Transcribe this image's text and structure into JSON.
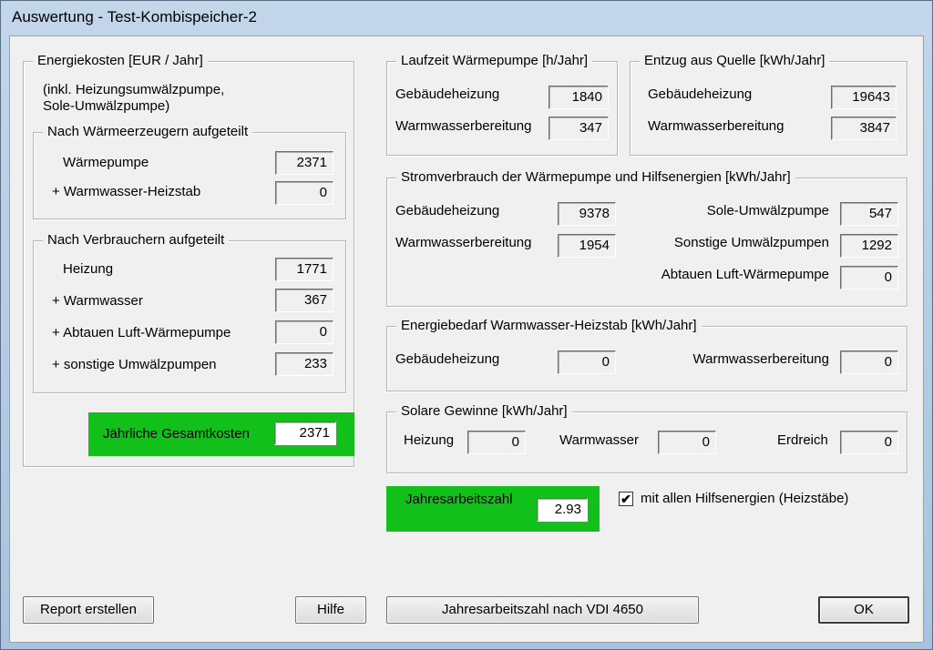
{
  "window": {
    "title": "Auswertung - Test-Kombispeicher-2"
  },
  "energiekosten": {
    "title": "Energiekosten [EUR / Jahr]",
    "note": "(inkl. Heizungsumwälzpumpe,\nSole-Umwälzpumpe)",
    "waermeerzeuger": {
      "title": "Nach Wärmeerzeugern aufgeteilt",
      "rows": [
        {
          "label": "Wärmepumpe",
          "value": "2371"
        },
        {
          "label": "+ Warmwasser-Heizstab",
          "value": "0"
        }
      ]
    },
    "verbraucher": {
      "title": "Nach Verbrauchern aufgeteilt",
      "rows": [
        {
          "label": "Heizung",
          "value": "1771"
        },
        {
          "label": "+ Warmwasser",
          "value": "367"
        },
        {
          "label": "+ Abtauen Luft-Wärmepumpe",
          "value": "0"
        },
        {
          "label": "+ sonstige Umwälzpumpen",
          "value": "233"
        }
      ]
    },
    "gesamt": {
      "label": "Jährliche Gesamtkosten",
      "value": "2371"
    }
  },
  "laufzeit": {
    "title": "Laufzeit Wärmepumpe [h/Jahr]",
    "rows": [
      {
        "label": "Gebäudeheizung",
        "value": "1840"
      },
      {
        "label": "Warmwasserbereitung",
        "value": "347"
      }
    ]
  },
  "entzug": {
    "title": "Entzug aus Quelle [kWh/Jahr]",
    "rows": [
      {
        "label": "Gebäudeheizung",
        "value": "19643"
      },
      {
        "label": "Warmwasserbereitung",
        "value": "3847"
      }
    ]
  },
  "strom": {
    "title": "Stromverbrauch der Wärmepumpe und Hilfsenergien [kWh/Jahr]",
    "left": [
      {
        "label": "Gebäudeheizung",
        "value": "9378"
      },
      {
        "label": "Warmwasserbereitung",
        "value": "1954"
      }
    ],
    "right": [
      {
        "label": "Sole-Umwälzpumpe",
        "value": "547"
      },
      {
        "label": "Sonstige Umwälzpumpen",
        "value": "1292"
      },
      {
        "label": "Abtauen Luft-Wärmepumpe",
        "value": "0"
      }
    ]
  },
  "heizstab": {
    "title": "Energiebedarf Warmwasser-Heizstab [kWh/Jahr]",
    "gebaeude": {
      "label": "Gebäudeheizung",
      "value": "0"
    },
    "warmwasser": {
      "label": "Warmwasserbereitung",
      "value": "0"
    }
  },
  "solar": {
    "title": "Solare Gewinne [kWh/Jahr]",
    "heizung": {
      "label": "Heizung",
      "value": "0"
    },
    "warmwasser": {
      "label": "Warmwasser",
      "value": "0"
    },
    "erdreich": {
      "label": "Erdreich",
      "value": "0"
    }
  },
  "jaz": {
    "label": "Jahresarbeitszahl",
    "value": "2.93",
    "checkbox_label": "mit allen Hilfsenergien (Heizstäbe)",
    "checkbox_mark": "✔"
  },
  "buttons": {
    "report": "Report erstellen",
    "hilfe": "Hilfe",
    "vdi": "Jahresarbeitszahl nach VDI 4650",
    "ok": "OK"
  },
  "colors": {
    "highlight": "#11c11a"
  }
}
